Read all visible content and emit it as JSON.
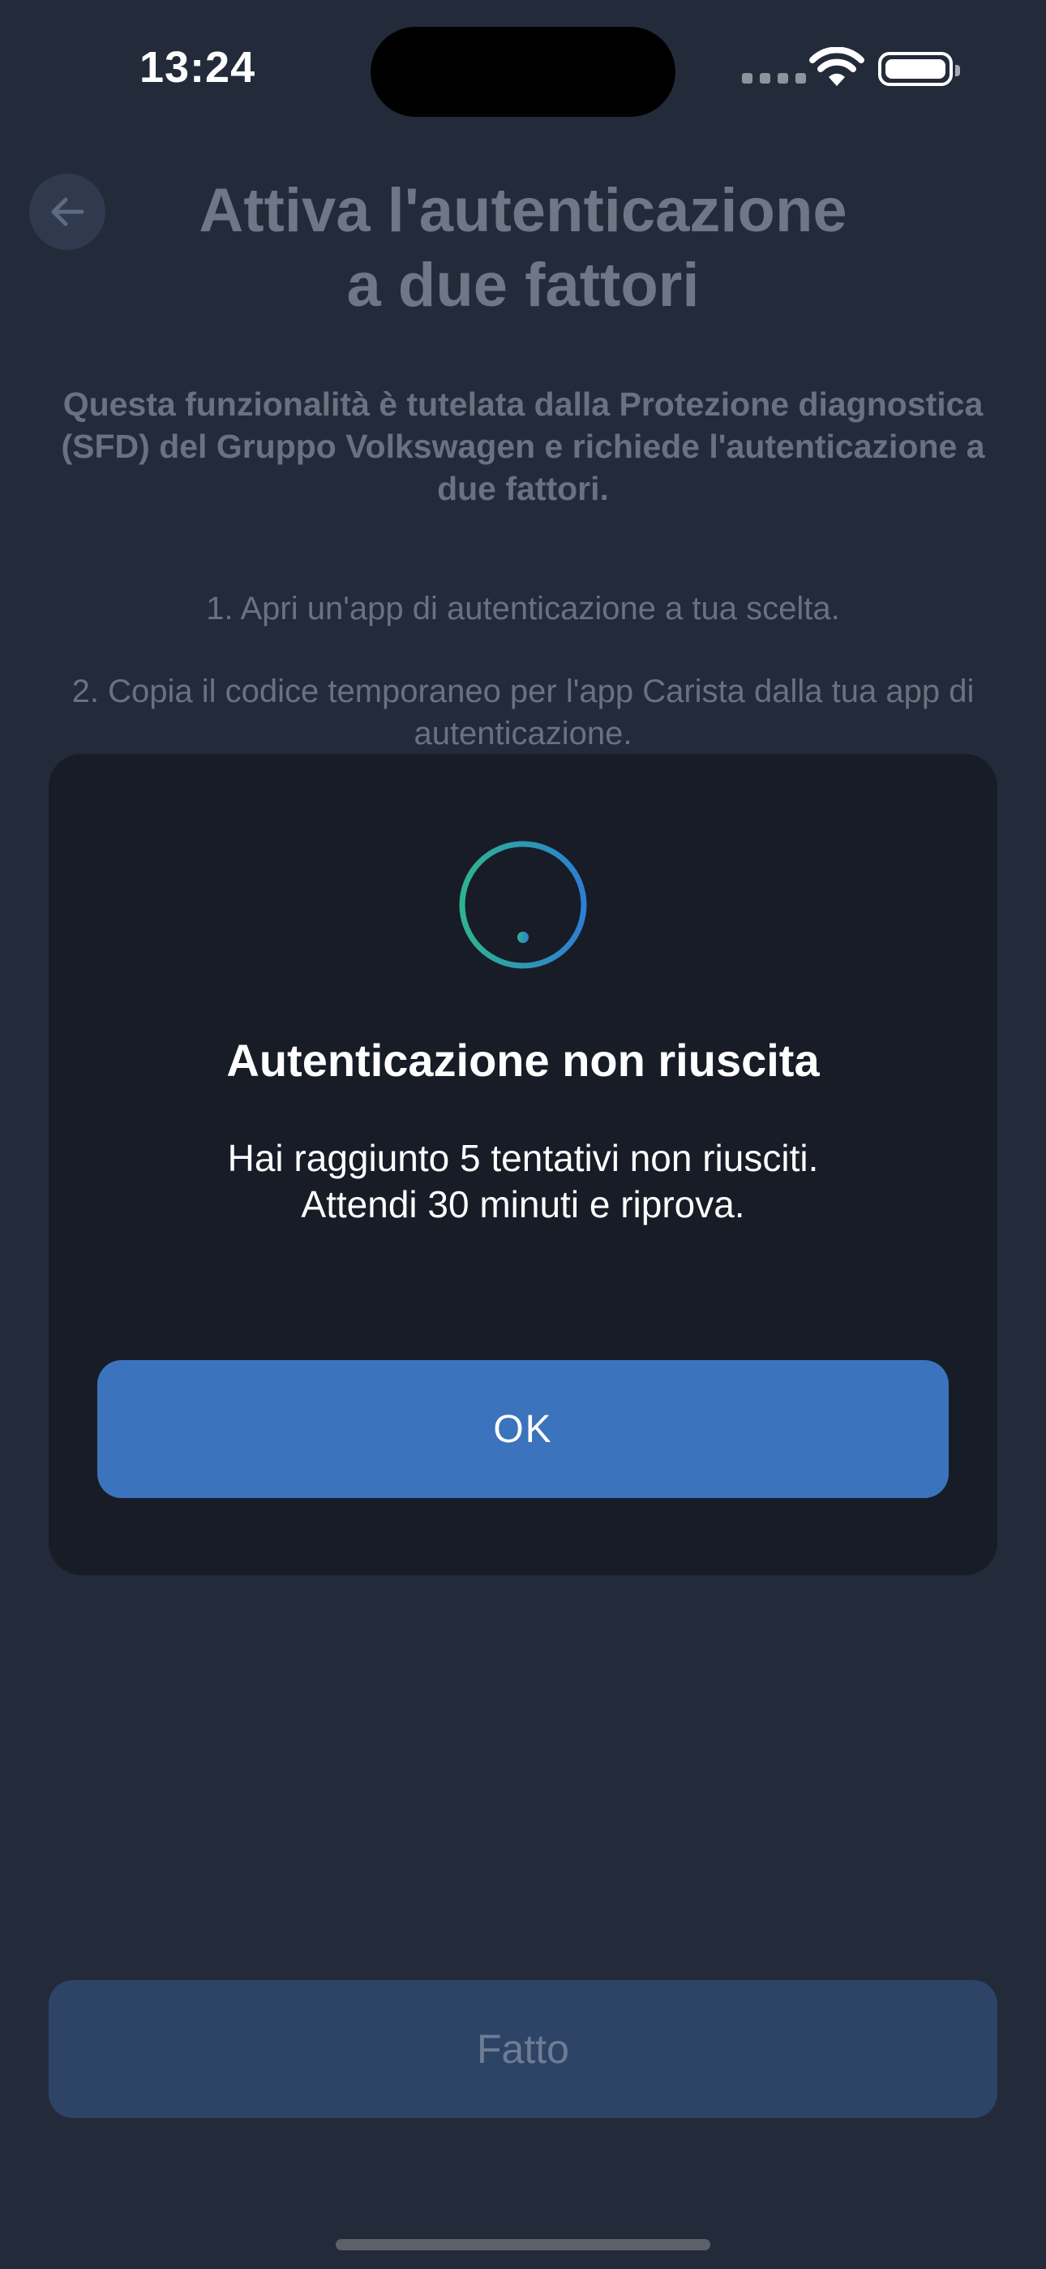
{
  "status_bar": {
    "time": "13:24",
    "icons": [
      "cellular-signal-icon",
      "wifi-icon",
      "battery-icon"
    ]
  },
  "header": {
    "back_icon": "arrow-left-icon",
    "title_line1": "Attiva l'autenticazione",
    "title_line2": "a due fattori"
  },
  "content": {
    "intro": "Questa funzionalità è tutelata dalla Protezione diagnostica (SFD) del Gruppo Volkswagen e richiede l'autenticazione a due fattori.",
    "step1": "1. Apri un'app di autenticazione a tua scelta.",
    "step2": "2. Copia il codice temporaneo per l'app Carista dalla tua app di autenticazione."
  },
  "dialog": {
    "icon": "exclamation-circle-icon",
    "title": "Autenticazione non riuscita",
    "message_line1": "Hai raggiunto 5 tentativi non riusciti.",
    "message_line2": "Attendi 30 minuti e riprova.",
    "ok_label": "OK"
  },
  "footer": {
    "done_label": "Fatto"
  },
  "colors": {
    "background": "#232b3b",
    "dialog_background": "#181c27",
    "primary_button": "#3b74bd",
    "disabled_button": "#2e4466",
    "icon_gradient_start": "#2fb38f",
    "icon_gradient_end": "#2d7fd3"
  }
}
